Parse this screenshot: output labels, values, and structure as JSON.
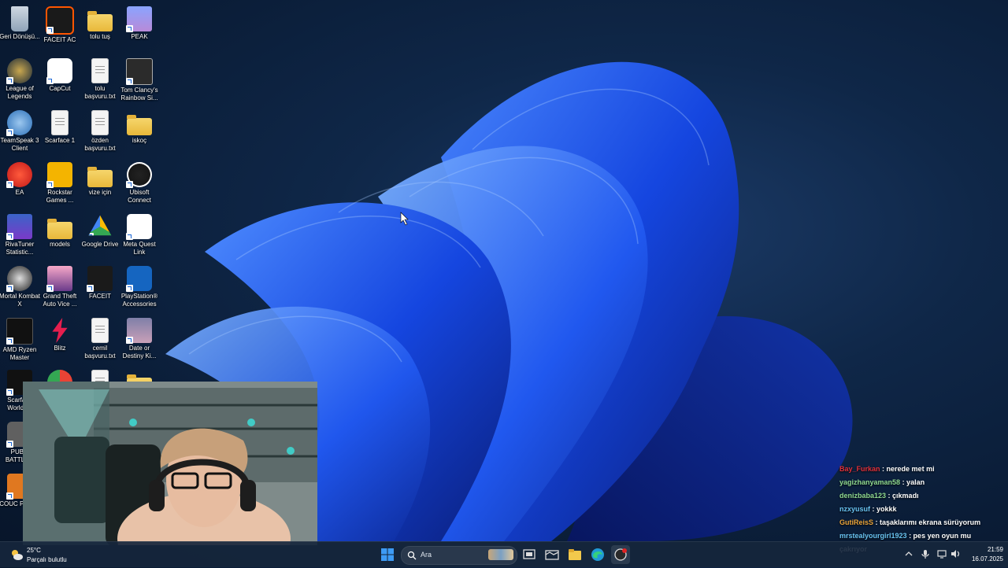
{
  "desktop": {
    "icons": [
      {
        "label": "Geri Dönüşü...",
        "icon": "recycle-bin-icon"
      },
      {
        "label": "FACEIT AC",
        "icon": "faceit-ac-icon"
      },
      {
        "label": "tolu tuş",
        "icon": "folder-icon"
      },
      {
        "label": "PEAK",
        "icon": "peak-icon"
      },
      {
        "label": "League of Legends",
        "icon": "league-of-legends-icon"
      },
      {
        "label": "CapCut",
        "icon": "capcut-icon"
      },
      {
        "label": "tolu başvuru.txt",
        "icon": "text-file-icon"
      },
      {
        "label": "Tom Clancy's Rainbow Si...",
        "icon": "rainbow-six-icon"
      },
      {
        "label": "TeamSpeak 3 Client",
        "icon": "teamspeak-icon"
      },
      {
        "label": "Scarface 1",
        "icon": "file-icon"
      },
      {
        "label": "özden başvuru.txt",
        "icon": "text-file-icon"
      },
      {
        "label": "iskoç",
        "icon": "folder-icon"
      },
      {
        "label": "EA",
        "icon": "ea-icon"
      },
      {
        "label": "Rockstar Games ...",
        "icon": "rockstar-icon"
      },
      {
        "label": "vize için",
        "icon": "folder-icon"
      },
      {
        "label": "Ubisoft Connect",
        "icon": "ubisoft-icon"
      },
      {
        "label": "RivaTuner Statistic...",
        "icon": "rivatuner-icon"
      },
      {
        "label": "models",
        "icon": "folder-icon"
      },
      {
        "label": "Google Drive",
        "icon": "google-drive-icon"
      },
      {
        "label": "Meta Quest Link",
        "icon": "meta-quest-icon"
      },
      {
        "label": "Mortal Kombat X",
        "icon": "mortal-kombat-icon"
      },
      {
        "label": "Grand Theft Auto Vice ...",
        "icon": "gta-vice-city-icon"
      },
      {
        "label": "FACEIT",
        "icon": "faceit-icon"
      },
      {
        "label": "PlayStation® Accessories",
        "icon": "playstation-icon"
      },
      {
        "label": "AMD Ryzen Master",
        "icon": "ryzen-master-icon"
      },
      {
        "label": "Blitz",
        "icon": "blitz-icon"
      },
      {
        "label": "cemil başvuru.txt",
        "icon": "text-file-icon"
      },
      {
        "label": "Date or Destiny Ki...",
        "icon": "date-or-destiny-icon"
      },
      {
        "label": "Scarface World i...",
        "icon": "scarface-world-icon"
      },
      {
        "label": "PUBG BATTLE...",
        "icon": "pubg-icon"
      },
      {
        "label": "COUC PURI...",
        "icon": "app-icon"
      }
    ]
  },
  "chat": {
    "messages": [
      {
        "user": "Bay_Furkan",
        "text": ": nerede met mi",
        "color": "#e0303a"
      },
      {
        "user": "yagizhanyaman58",
        "text": ": yalan",
        "color": "#8fd88f"
      },
      {
        "user": "denizbaba123",
        "text": ": çıkmadı",
        "color": "#8fd88f"
      },
      {
        "user": "nzxyusuf",
        "text": ": yokkk",
        "color": "#68c2f0"
      },
      {
        "user": "GutiReisS",
        "text": ": taşaklarımı ekrana sürüyorum",
        "color": "#e8a33a"
      },
      {
        "user": "mrstealyourgirl1923",
        "text": ": pes yen oyun mu",
        "color": "#68c2f0"
      },
      {
        "user": "",
        "text": "çakrıyor",
        "color": "#ffffff"
      }
    ]
  },
  "taskbar": {
    "weather_temp": "25°C",
    "weather_desc": "Parçalı bulutlu",
    "search_placeholder": "Ara",
    "time": "21:59",
    "date": "16.07.2025"
  },
  "colors": {
    "taskbar_bg": "#16263c",
    "wallpaper_accent": "#1a5cff",
    "windows_blue": "#3d9bf5"
  }
}
